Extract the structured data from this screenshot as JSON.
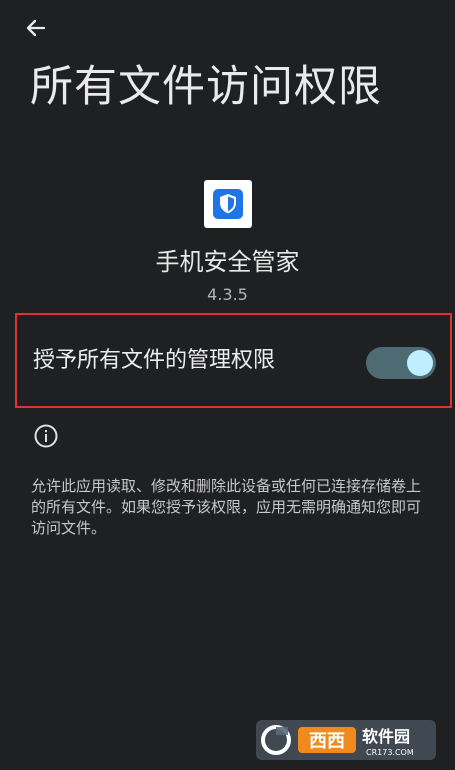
{
  "header": {
    "back_icon": "arrow-left-icon",
    "title": "所有文件访问权限"
  },
  "app": {
    "icon": "shield-check-icon",
    "name": "手机安全管家",
    "version": "4.3.5"
  },
  "permission": {
    "label": "授予所有文件的管理权限",
    "enabled": true,
    "highlight_color": "#e0322e"
  },
  "info": {
    "icon": "info-icon",
    "description": "允许此应用读取、修改和删除此设备或任何已连接存储卷上的所有文件。如果您授予该权限，应用无需明确通知您即可访问文件。"
  },
  "watermark": {
    "logo_text": "西西软件园",
    "logo_sub": "CR173.COM"
  },
  "colors": {
    "background": "#1f2022",
    "toggle_track": "#4e6b74",
    "toggle_thumb": "#bfefff",
    "app_icon_blue": "#1f74e8"
  }
}
